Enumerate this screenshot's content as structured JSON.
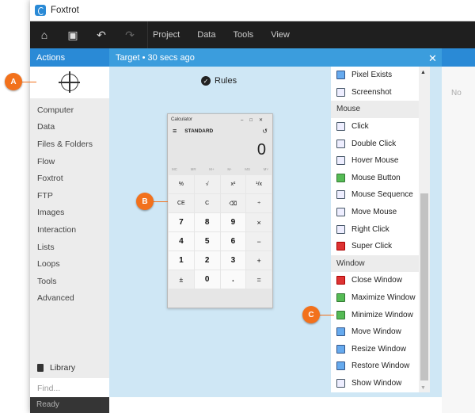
{
  "app": {
    "title": "Foxtrot"
  },
  "toolbar": {
    "menus": [
      "Project",
      "Data",
      "Tools",
      "View"
    ]
  },
  "left": {
    "header": "Actions",
    "categories": [
      "Computer",
      "Data",
      "Files & Folders",
      "Flow",
      "Foxtrot",
      "FTP",
      "Images",
      "Interaction",
      "Lists",
      "Loops",
      "Tools",
      "Advanced"
    ],
    "library_label": "Library",
    "find_placeholder": "Find...",
    "status": "Ready"
  },
  "main": {
    "header": "Target  •  30 secs ago",
    "rules_label": "Rules"
  },
  "calculator": {
    "title": "Calculator",
    "mode": "STANDARD",
    "display": "0",
    "memory": [
      "MC",
      "MR",
      "M+",
      "M-",
      "MS",
      "M˅"
    ],
    "keys": [
      "%",
      "√",
      "x²",
      "¹/x",
      "CE",
      "C",
      "⌫",
      "÷",
      "7",
      "8",
      "9",
      "×",
      "4",
      "5",
      "6",
      "−",
      "1",
      "2",
      "3",
      "+",
      "±",
      "0",
      ".",
      "="
    ]
  },
  "side": {
    "top_items": [
      {
        "label": "Pixel Exists"
      },
      {
        "label": "Screenshot"
      }
    ],
    "mouse_section": "Mouse",
    "mouse_items": [
      {
        "label": "Click"
      },
      {
        "label": "Double Click"
      },
      {
        "label": "Hover Mouse"
      },
      {
        "label": "Mouse Button"
      },
      {
        "label": "Mouse Sequence"
      },
      {
        "label": "Move Mouse"
      },
      {
        "label": "Right Click"
      },
      {
        "label": "Super Click"
      }
    ],
    "window_section": "Window",
    "window_items": [
      {
        "label": "Close Window"
      },
      {
        "label": "Maximize Window"
      },
      {
        "label": "Minimize Window"
      },
      {
        "label": "Move Window"
      },
      {
        "label": "Resize Window"
      },
      {
        "label": "Restore Window"
      },
      {
        "label": "Show Window"
      }
    ]
  },
  "callouts": {
    "a": "A",
    "b": "B",
    "c": "C"
  },
  "background": {
    "faded_text": "No"
  },
  "colors": {
    "accent": "#2a8ad6",
    "callout": "#f2711c"
  }
}
